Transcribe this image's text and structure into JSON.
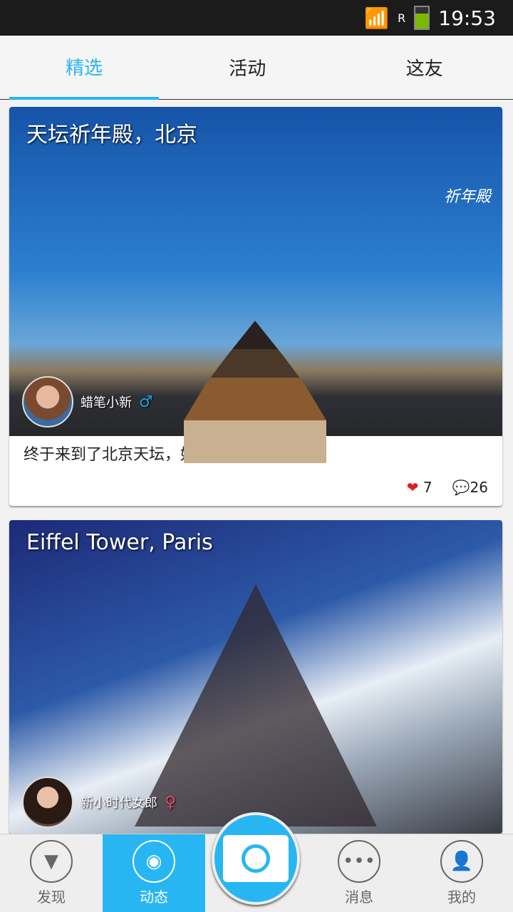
{
  "status": {
    "time": "19:53",
    "roaming": "R"
  },
  "tabs": [
    {
      "label": "精选"
    },
    {
      "label": "活动"
    },
    {
      "label": "这友"
    }
  ],
  "posts": [
    {
      "title": "天坛祈年殿，北京",
      "watermark": "祈年殿",
      "author": "蜡笔小新",
      "gender": "♂",
      "gender_color": "#1aa0e0",
      "text": "终于来到了北京天坛，好开心~。",
      "likes": "7",
      "comments": "26"
    },
    {
      "title": "Eiffel Tower, Paris",
      "author": "新小时代女郎",
      "gender": "♀",
      "gender_color": "#e84a6a"
    }
  ],
  "nav": [
    {
      "label": "发现"
    },
    {
      "label": "动态"
    },
    {
      "label": "消息"
    },
    {
      "label": "我的"
    }
  ],
  "accent": "#28b6f3"
}
